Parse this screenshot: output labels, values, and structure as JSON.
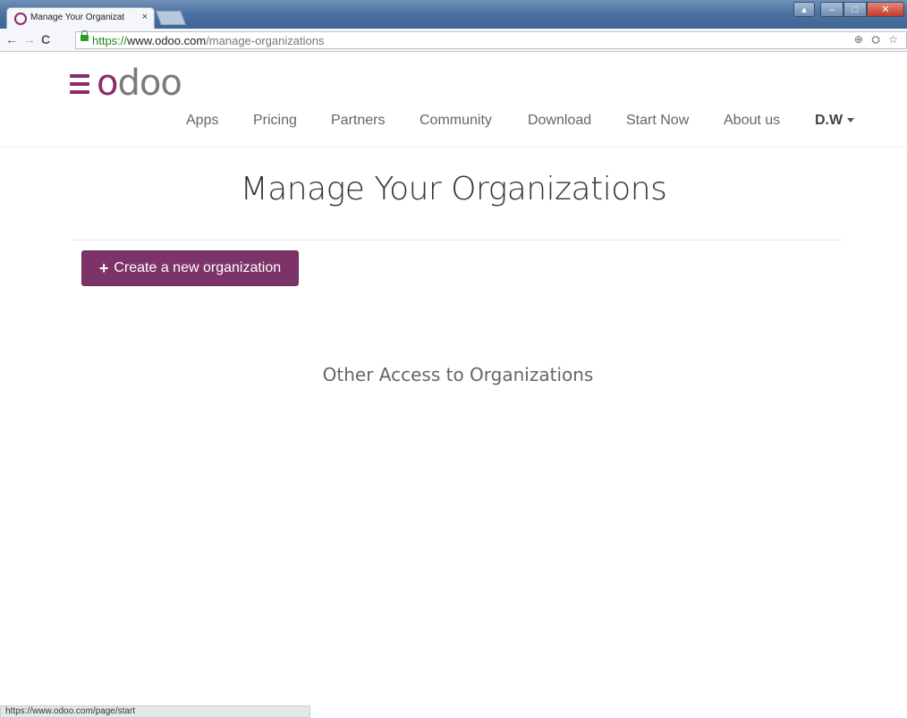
{
  "browser": {
    "tab_title": "Manage Your Organizat",
    "tab_close": "×",
    "url_scheme": "https://",
    "url_host": "www.odoo.com",
    "url_path": "/manage-organizations",
    "back": "←",
    "forward": "→",
    "reload": "C",
    "status_url": "https://www.odoo.com/page/start"
  },
  "header": {
    "logo_text_o": "o",
    "logo_text_rest": "doo",
    "nav": [
      "Apps",
      "Pricing",
      "Partners",
      "Community",
      "Download",
      "Start Now",
      "About us"
    ],
    "user": "D.W"
  },
  "main": {
    "title": "Manage Your Organizations",
    "create_button": "Create a new organization",
    "create_icon": "+",
    "other_access_title": "Other Access to Organizations"
  },
  "colors": {
    "brand": "#7c3368"
  }
}
